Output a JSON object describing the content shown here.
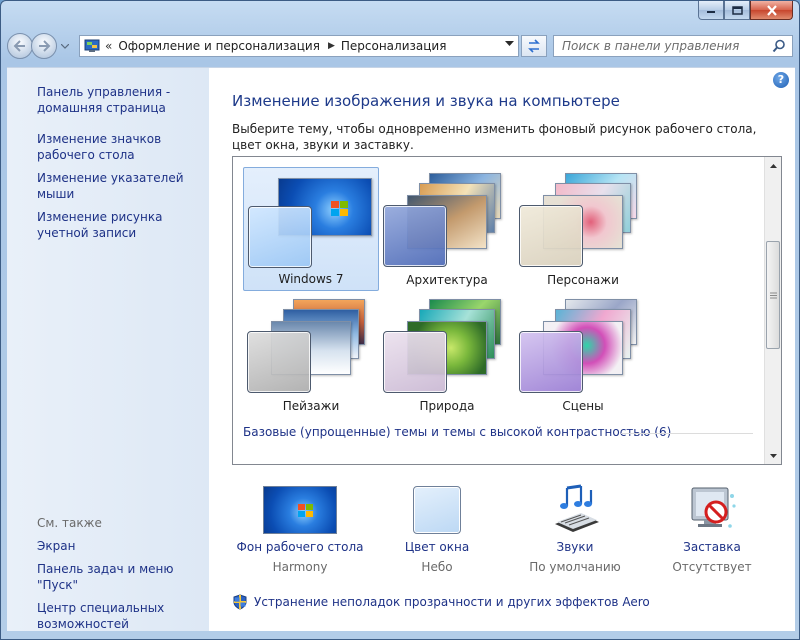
{
  "window": {
    "nav": {
      "breadcrumb": [
        "Оформление и персонализация",
        "Персонализация"
      ],
      "search_placeholder": "Поиск в панели управления"
    }
  },
  "left_pane": {
    "links": [
      "Панель управления - домашняя страница",
      "Изменение значков рабочего стола",
      "Изменение указателей мыши",
      "Изменение рисунка учетной записи"
    ],
    "see_also_label": "См. также",
    "see_also_links": [
      "Экран",
      "Панель задач и меню \"Пуск\"",
      "Центр специальных возможностей"
    ]
  },
  "main": {
    "heading": "Изменение изображения и звука на компьютере",
    "description": "Выберите тему, чтобы одновременно изменить фоновый рисунок рабочего стола, цвет окна, звуки и заставку.",
    "themes": [
      {
        "label": "Windows 7",
        "selected": true
      },
      {
        "label": "Архитектура",
        "selected": false
      },
      {
        "label": "Персонажи",
        "selected": false
      },
      {
        "label": "Пейзажи",
        "selected": false
      },
      {
        "label": "Природа",
        "selected": false
      },
      {
        "label": "Сцены",
        "selected": false
      }
    ],
    "basic_themes_label": "Базовые (упрощенные) темы и темы с высокой контрастностью (6)",
    "bottom_items": [
      {
        "title": "Фон рабочего стола",
        "subtitle": "Harmony"
      },
      {
        "title": "Цвет окна",
        "subtitle": "Небо"
      },
      {
        "title": "Звуки",
        "subtitle": "По умолчанию"
      },
      {
        "title": "Заставка",
        "subtitle": "Отсутствует"
      }
    ],
    "aero_link": "Устранение неполадок прозрачности и других эффектов Aero"
  },
  "colors": {
    "link": "#1e3287",
    "heading": "#1e3a8a",
    "selection": "#cfe2f8"
  }
}
